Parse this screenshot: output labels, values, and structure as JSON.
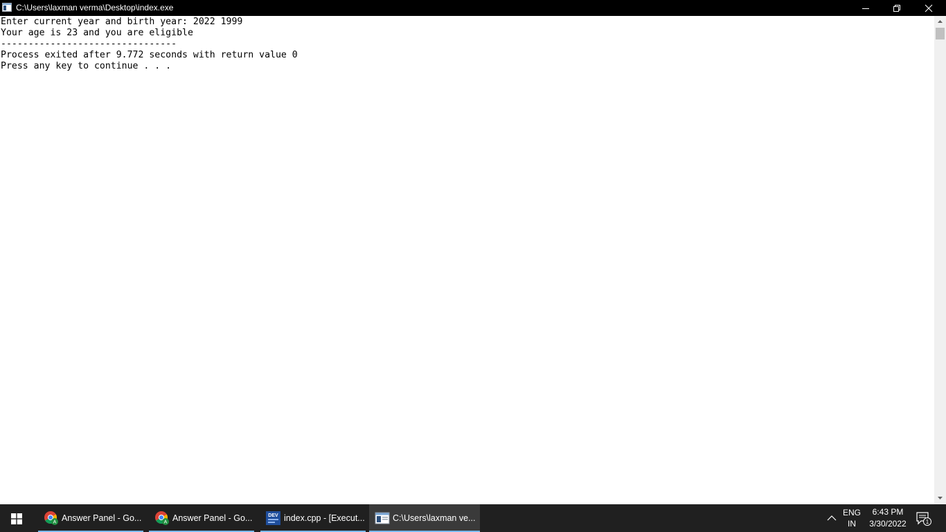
{
  "window": {
    "title": "C:\\Users\\laxman verma\\Desktop\\index.exe"
  },
  "console": {
    "lines": [
      "Enter current year and birth year: 2022 1999",
      "Your age is 23 and you are eligible",
      "--------------------------------",
      "Process exited after 9.772 seconds with return value 0",
      "Press any key to continue . . ."
    ]
  },
  "taskbar": {
    "items": [
      {
        "label": "Answer Panel - Go...",
        "icon": "chrome-icon"
      },
      {
        "label": "Answer Panel - Go...",
        "icon": "chrome-icon"
      },
      {
        "label": "index.cpp - [Execut...",
        "icon": "dev-cpp-icon",
        "icon_text": "DEV"
      },
      {
        "label": "C:\\Users\\laxman ve...",
        "icon": "console-icon",
        "active": true
      }
    ],
    "tray": {
      "lang_top": "ENG",
      "lang_bottom": "IN",
      "time": "6:43 PM",
      "date": "3/30/2022",
      "notification_count": "1"
    }
  },
  "colors": {
    "titlebar": "#000000",
    "console_bg": "#ffffff",
    "console_text": "#000000",
    "taskbar": "#202020",
    "taskbar_active": "#3a3a3a",
    "accent": "#76b9ed"
  }
}
